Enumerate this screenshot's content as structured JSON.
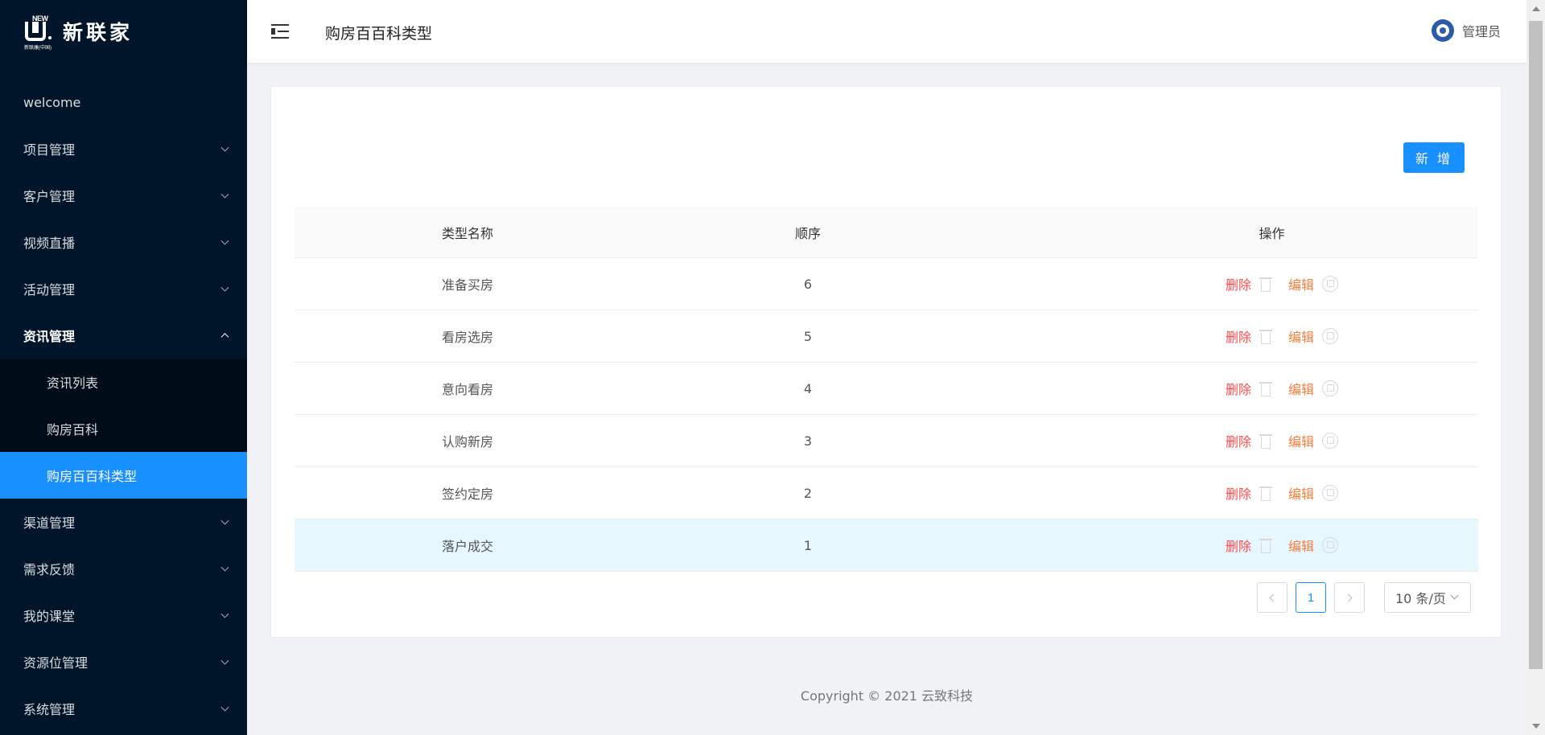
{
  "logo": {
    "badge": "NEW",
    "sub": "新联康(中国)",
    "name": "新联家"
  },
  "header": {
    "title": "购房百百科类型",
    "username": "管理员"
  },
  "sidebar": {
    "items": [
      {
        "label": "welcome"
      },
      {
        "label": "项目管理"
      },
      {
        "label": "客户管理"
      },
      {
        "label": "视频直播"
      },
      {
        "label": "活动管理"
      },
      {
        "label": "资讯管理"
      },
      {
        "label": "渠道管理"
      },
      {
        "label": "需求反馈"
      },
      {
        "label": "我的课堂"
      },
      {
        "label": "资源位管理"
      },
      {
        "label": "系统管理"
      }
    ],
    "submenu": [
      {
        "label": "资讯列表"
      },
      {
        "label": "购房百科"
      },
      {
        "label": "购房百百科类型"
      }
    ]
  },
  "toolbar": {
    "add_label": "新 增"
  },
  "table": {
    "headers": [
      "类型名称",
      "顺序",
      "操作"
    ],
    "rows": [
      {
        "name": "准备买房",
        "order": "6"
      },
      {
        "name": "看房选房",
        "order": "5"
      },
      {
        "name": "意向看房",
        "order": "4"
      },
      {
        "name": "认购新房",
        "order": "3"
      },
      {
        "name": "签约定房",
        "order": "2"
      },
      {
        "name": "落户成交",
        "order": "1"
      }
    ],
    "actions": {
      "delete": "删除",
      "edit": "编辑"
    }
  },
  "pagination": {
    "current": "1",
    "page_size": "10 条/页"
  },
  "footer": {
    "copyright": "Copyright © 2021 云致科技"
  },
  "colors": {
    "sidebar_bg": "#001529",
    "accent": "#1890ff",
    "delete": "#ff4d4f",
    "edit": "#fa7d3c"
  }
}
